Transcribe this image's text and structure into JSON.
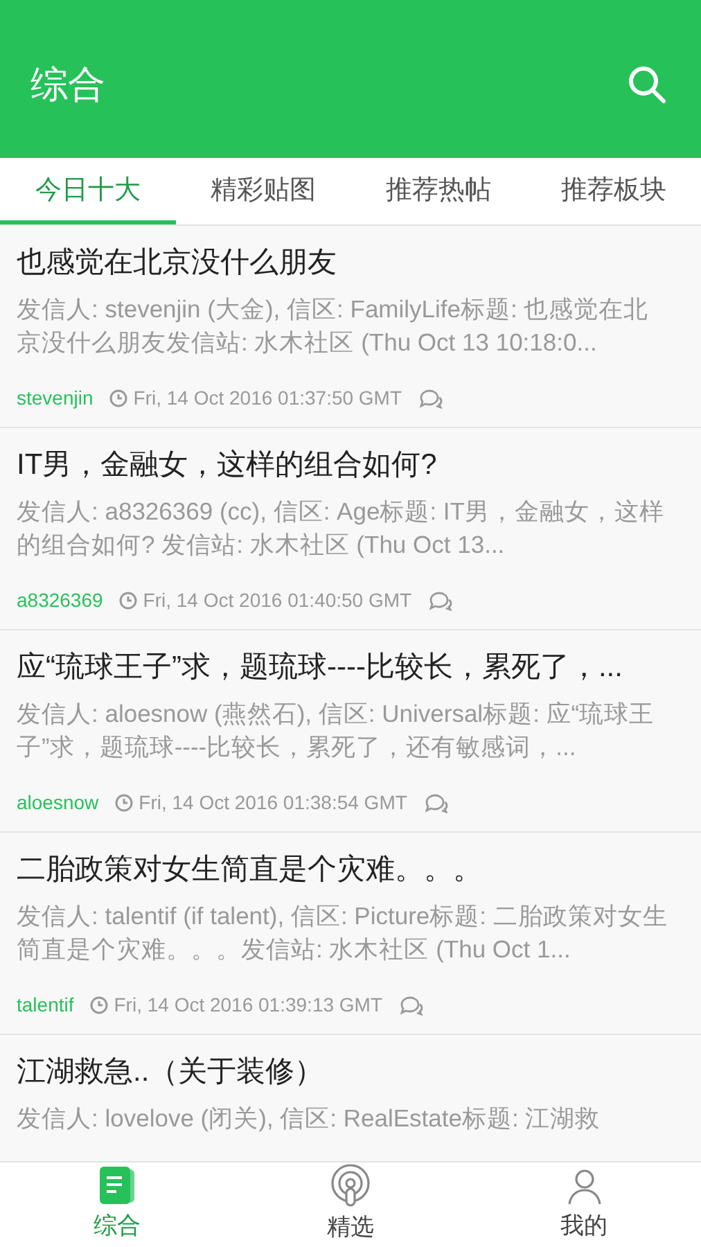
{
  "header": {
    "title": "综合"
  },
  "tabs": [
    {
      "label": "今日十大",
      "selected": true
    },
    {
      "label": "精彩贴图",
      "selected": false
    },
    {
      "label": "推荐热帖",
      "selected": false
    },
    {
      "label": "推荐板块",
      "selected": false
    }
  ],
  "posts": [
    {
      "title": "也感觉在北京没什么朋友",
      "preview": "发信人: stevenjin (大金), 信区: FamilyLife标题: 也感觉在北京没什么朋友发信站: 水木社区 (Thu Oct 13 10:18:0...",
      "author": "stevenjin",
      "time": "Fri, 14 Oct 2016 01:37:50 GMT"
    },
    {
      "title": "IT男，金融女，这样的组合如何?",
      "preview": "发信人: a8326369 (cc), 信区: Age标题: IT男，金融女，这样的组合如何? 发信站: 水木社区 (Thu Oct 13...",
      "author": "a8326369",
      "time": "Fri, 14 Oct 2016 01:40:50 GMT"
    },
    {
      "title": "应“琉球王子”求，题琉球----比较长，累死了，...",
      "preview": "发信人: aloesnow (燕然石), 信区: Universal标题: 应“琉球王子”求，题琉球----比较长，累死了，还有敏感词，...",
      "author": "aloesnow",
      "time": "Fri, 14 Oct 2016 01:38:54 GMT"
    },
    {
      "title": "二胎政策对女生简直是个灾难。。。",
      "preview": "发信人: talentif (if talent), 信区: Picture标题: 二胎政策对女生简直是个灾难。。。发信站: 水木社区 (Thu Oct 1...",
      "author": "talentif",
      "time": "Fri, 14 Oct 2016 01:39:13 GMT"
    },
    {
      "title": "江湖救急..（关于装修）",
      "preview": "发信人: lovelove (闭关), 信区: RealEstate标题: 江湖救"
    }
  ],
  "bottom_nav": [
    {
      "label": "综合",
      "kind": "docs",
      "selected": true
    },
    {
      "label": "精选",
      "kind": "pick",
      "selected": false
    },
    {
      "label": "我的",
      "kind": "me",
      "selected": false
    }
  ]
}
